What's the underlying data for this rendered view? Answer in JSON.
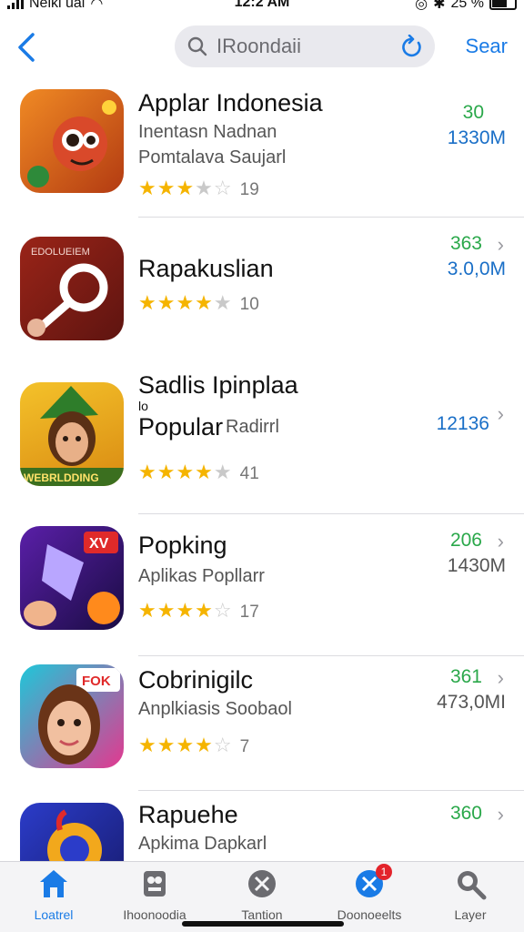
{
  "status_bar": {
    "carrier": "Neikl ual",
    "time": "12:2 AM",
    "battery": "25 %"
  },
  "search": {
    "value": "IRoondaii",
    "button_label": "Sear"
  },
  "apps": [
    {
      "title": "Applar Indonesia",
      "line1": "Inentasn Nadnan",
      "line2": "Pomtalava Saujarl",
      "stars": 3.5,
      "rating_count": "19",
      "metric_top": "30",
      "metric_bottom": "1330M",
      "icon_colors": [
        "#e8641c",
        "#7b2a12"
      ]
    },
    {
      "title": "Rapakuslian",
      "line1": "",
      "line2": "",
      "stars": 4.5,
      "rating_count": "10",
      "metric_top": "363",
      "metric_bottom": "3.0,0M",
      "icon_colors": [
        "#8a1f18",
        "#5e1410"
      ]
    },
    {
      "title": "Sadlis Ipinplaa",
      "line1": "lo",
      "line2": "Popular",
      "line2_extra": "Radirrl",
      "stars": 4.5,
      "rating_count": "41",
      "metric_top": "",
      "metric_bottom": "12136",
      "icon_colors": [
        "#f2b21c",
        "#2e7d2a"
      ]
    },
    {
      "title": "Popking",
      "line1": "Aplikas Popllarr",
      "line2": "",
      "stars": 4.5,
      "rating_count": "17",
      "metric_top": "206",
      "metric_bottom": "1430M",
      "icon_colors": [
        "#6a1fb0",
        "#1e0e4a"
      ],
      "icon_badge": "XV"
    },
    {
      "title": "Cobrinigilc",
      "line1": "Anplkiasis Soobaol",
      "line2": "",
      "stars": 4,
      "rating_count": "7",
      "metric_top": "361",
      "metric_bottom": "473,0MI",
      "icon_colors": [
        "#23c7d9",
        "#e3388f"
      ],
      "icon_badge": "FOK"
    },
    {
      "title": "Rapuehe",
      "line1": "Apkima Dapkarl",
      "line2": "",
      "stars": 0,
      "rating_count": "",
      "metric_top": "360",
      "metric_bottom": "",
      "icon_colors": [
        "#2b3cc9",
        "#f2a81c"
      ]
    }
  ],
  "tabs": [
    {
      "label": "Loatrel",
      "icon": "home-icon",
      "active": true
    },
    {
      "label": "Ihoonoodia",
      "icon": "games-icon",
      "active": false
    },
    {
      "label": "Tantion",
      "icon": "apps-icon",
      "active": false
    },
    {
      "label": "Doonoeelts",
      "icon": "updates-icon",
      "active": false,
      "badge": "1"
    },
    {
      "label": "Layer",
      "icon": "search-icon",
      "active": false
    }
  ]
}
